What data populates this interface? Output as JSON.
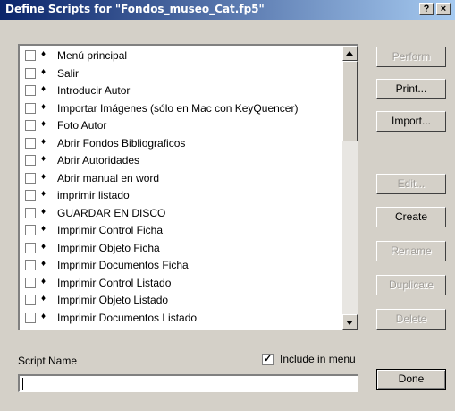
{
  "window": {
    "title": "Define Scripts for \"Fondos_museo_Cat.fp5\"",
    "help_label": "?",
    "close_label": "×"
  },
  "scripts": [
    "Menú principal",
    "Salir",
    "Introducir Autor",
    "Importar Imágenes (sólo en Mac con KeyQuencer)",
    "Foto Autor",
    "Abrir Fondos Bibliograficos",
    "Abrir Autoridades",
    "Abrir manual en word",
    "imprimir listado",
    "GUARDAR EN DISCO",
    "Imprimir Control Ficha",
    "Imprimir Objeto Ficha",
    "Imprimir Documentos Ficha",
    "Imprimir Control Listado",
    "Imprimir Objeto Listado",
    "Imprimir Documentos Listado"
  ],
  "buttons": {
    "perform": {
      "label": "Perform",
      "enabled": false
    },
    "print": {
      "label": "Print...",
      "enabled": true
    },
    "import": {
      "label": "Import...",
      "enabled": true
    },
    "edit": {
      "label": "Edit...",
      "enabled": false
    },
    "create": {
      "label": "Create",
      "enabled": true
    },
    "rename": {
      "label": "Rename",
      "enabled": false
    },
    "duplicate": {
      "label": "Duplicate",
      "enabled": false
    },
    "delete": {
      "label": "Delete",
      "enabled": false
    },
    "done": {
      "label": "Done",
      "enabled": true
    }
  },
  "script_name": {
    "label": "Script Name",
    "value": ""
  },
  "include_in_menu": {
    "label": "Include in menu",
    "checked": true
  }
}
